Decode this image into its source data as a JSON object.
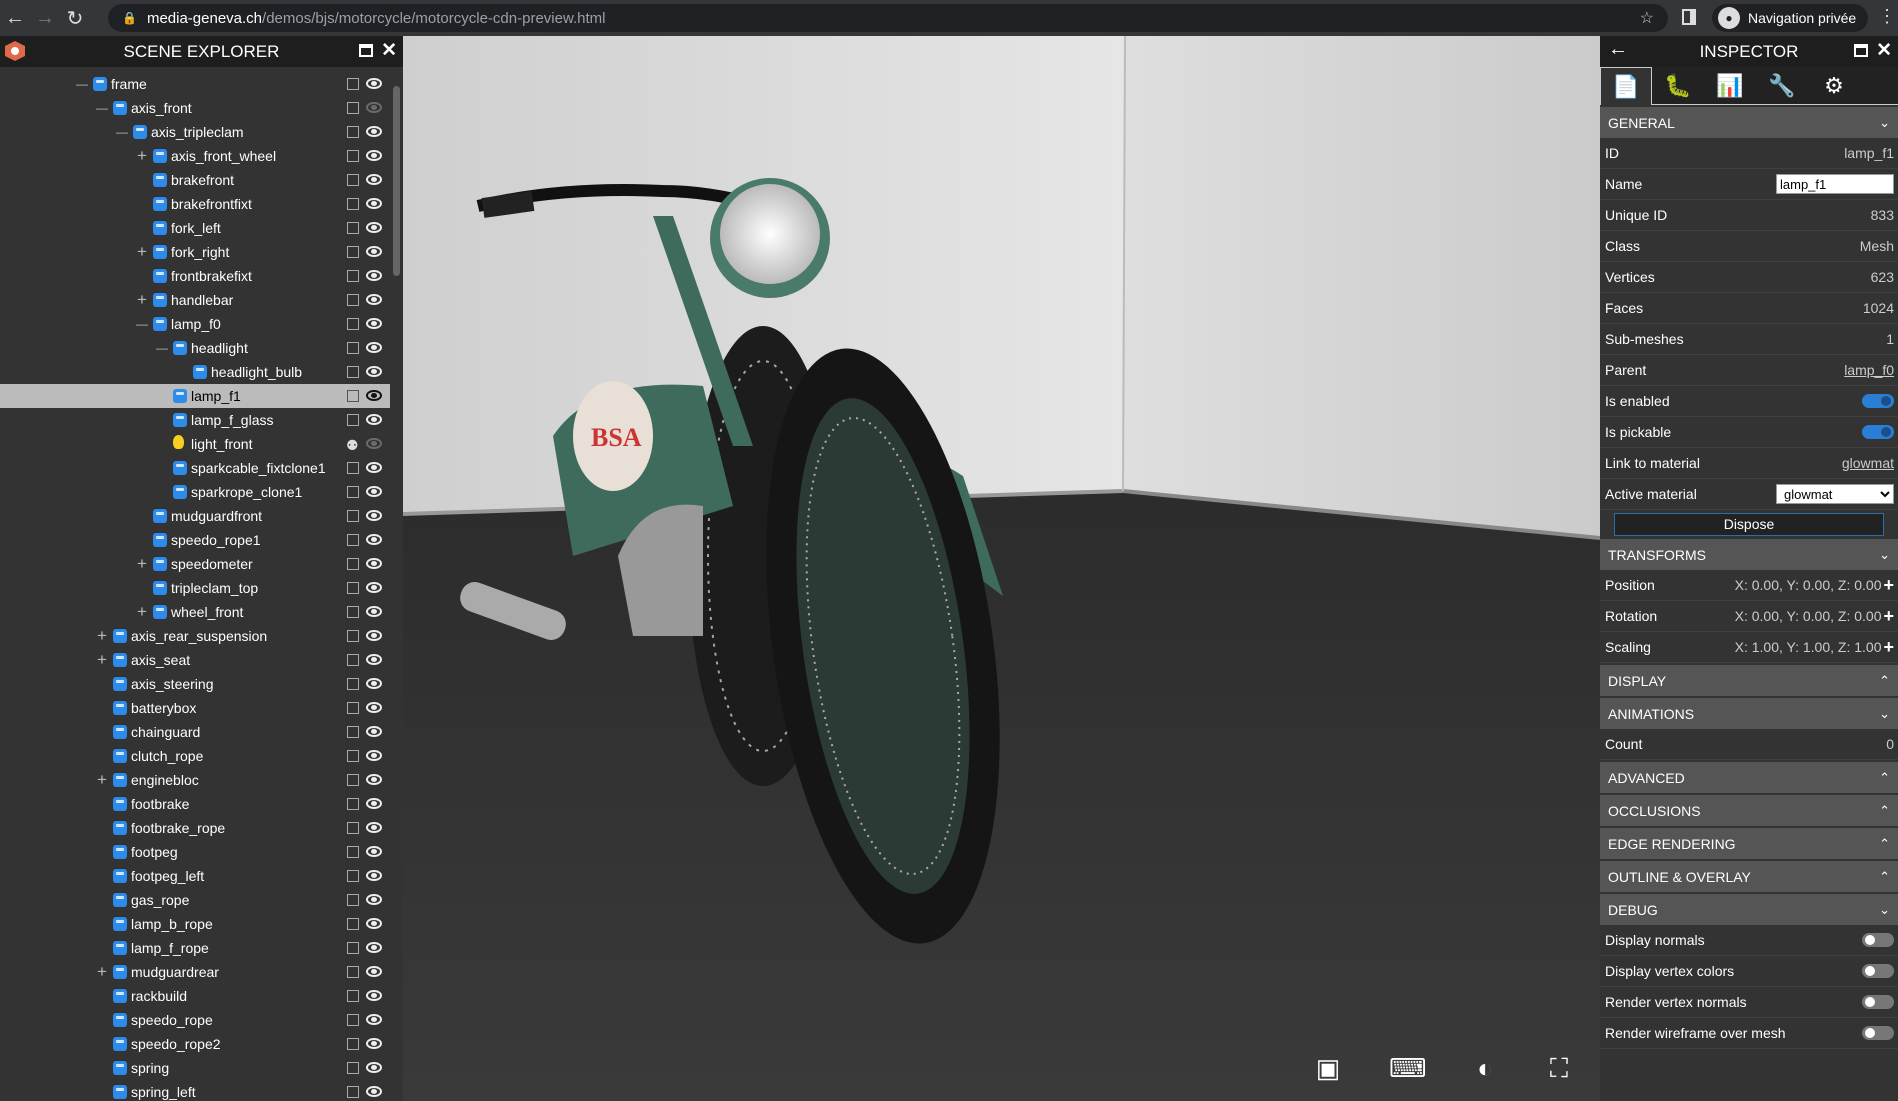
{
  "browser": {
    "url_host": "media-geneva.ch",
    "url_path": "/demos/bjs/motorcycle/motorcycle-cdn-preview.html",
    "private_label": "Navigation privée"
  },
  "explorer": {
    "title": "SCENE EXPLORER",
    "items": [
      {
        "label": "frame",
        "level": 0,
        "exp": "-"
      },
      {
        "label": "axis_front",
        "level": 1,
        "exp": "-",
        "hidden": true
      },
      {
        "label": "axis_tripleclam",
        "level": 2,
        "exp": "-"
      },
      {
        "label": "axis_front_wheel",
        "level": 3,
        "exp": "+"
      },
      {
        "label": "brakefront",
        "level": 3
      },
      {
        "label": "brakefrontfixt",
        "level": 3
      },
      {
        "label": "fork_left",
        "level": 3
      },
      {
        "label": "fork_right",
        "level": 3,
        "exp": "+"
      },
      {
        "label": "frontbrakefixt",
        "level": 3
      },
      {
        "label": "handlebar",
        "level": 3,
        "exp": "+"
      },
      {
        "label": "lamp_f0",
        "level": 3,
        "exp": "-"
      },
      {
        "label": "headlight",
        "level": 4,
        "exp": "-"
      },
      {
        "label": "headlight_bulb",
        "level": 5
      },
      {
        "label": "lamp_f1",
        "level": 4,
        "selected": true
      },
      {
        "label": "lamp_f_glass",
        "level": 4
      },
      {
        "label": "light_front",
        "level": 4,
        "type": "light"
      },
      {
        "label": "sparkcable_fixtclone1",
        "level": 4
      },
      {
        "label": "sparkrope_clone1",
        "level": 4
      },
      {
        "label": "mudguardfront",
        "level": 3
      },
      {
        "label": "speedo_rope1",
        "level": 3
      },
      {
        "label": "speedometer",
        "level": 3,
        "exp": "+"
      },
      {
        "label": "tripleclam_top",
        "level": 3
      },
      {
        "label": "wheel_front",
        "level": 3,
        "exp": "+"
      },
      {
        "label": "axis_rear_suspension",
        "level": 1,
        "exp": "+"
      },
      {
        "label": "axis_seat",
        "level": 1,
        "exp": "+"
      },
      {
        "label": "axis_steering",
        "level": 1
      },
      {
        "label": "batterybox",
        "level": 1
      },
      {
        "label": "chainguard",
        "level": 1
      },
      {
        "label": "clutch_rope",
        "level": 1
      },
      {
        "label": "enginebloc",
        "level": 1,
        "exp": "+"
      },
      {
        "label": "footbrake",
        "level": 1
      },
      {
        "label": "footbrake_rope",
        "level": 1
      },
      {
        "label": "footpeg",
        "level": 1
      },
      {
        "label": "footpeg_left",
        "level": 1
      },
      {
        "label": "gas_rope",
        "level": 1
      },
      {
        "label": "lamp_b_rope",
        "level": 1
      },
      {
        "label": "lamp_f_rope",
        "level": 1
      },
      {
        "label": "mudguardrear",
        "level": 1,
        "exp": "+"
      },
      {
        "label": "rackbuild",
        "level": 1
      },
      {
        "label": "speedo_rope",
        "level": 1
      },
      {
        "label": "speedo_rope2",
        "level": 1
      },
      {
        "label": "spring",
        "level": 1
      },
      {
        "label": "spring_left",
        "level": 1
      }
    ]
  },
  "viewport": {
    "tank_logo": "BSA",
    "buttons": [
      "screenshot-icon",
      "keyboard-icon",
      "contrast-icon",
      "fullscreen-icon"
    ]
  },
  "inspector": {
    "title": "INSPECTOR",
    "tabs": [
      "properties-icon",
      "debug-icon",
      "statistics-icon",
      "tools-icon",
      "settings-icon"
    ],
    "general": {
      "title": "GENERAL",
      "id": "lamp_f1",
      "name": "lamp_f1",
      "unique_id": "833",
      "class": "Mesh",
      "vertices": "623",
      "faces": "1024",
      "submeshes": "1",
      "parent": "lamp_f0",
      "is_enabled": true,
      "is_pickable": true,
      "link_to_material": "glowmat",
      "active_material": "glowmat",
      "dispose": "Dispose",
      "labels": {
        "id": "ID",
        "name": "Name",
        "unique_id": "Unique ID",
        "class": "Class",
        "vertices": "Vertices",
        "faces": "Faces",
        "submeshes": "Sub-meshes",
        "parent": "Parent",
        "is_enabled": "Is enabled",
        "is_pickable": "Is pickable",
        "link": "Link to material",
        "active": "Active material"
      }
    },
    "transforms": {
      "title": "TRANSFORMS",
      "position_label": "Position",
      "position": "X: 0.00, Y: 0.00, Z: 0.00",
      "rotation_label": "Rotation",
      "rotation": "X: 0.00, Y: 0.00, Z: 0.00",
      "scaling_label": "Scaling",
      "scaling": "X: 1.00, Y: 1.00, Z: 1.00"
    },
    "display": {
      "title": "DISPLAY"
    },
    "animations": {
      "title": "ANIMATIONS",
      "count_label": "Count",
      "count": "0"
    },
    "advanced": {
      "title": "ADVANCED"
    },
    "occlusions": {
      "title": "OCCLUSIONS"
    },
    "edge": {
      "title": "EDGE RENDERING"
    },
    "outline": {
      "title": "OUTLINE & OVERLAY"
    },
    "debug": {
      "title": "DEBUG",
      "items": [
        {
          "label": "Display normals",
          "on": false
        },
        {
          "label": "Display vertex colors",
          "on": false
        },
        {
          "label": "Render vertex normals",
          "on": false
        },
        {
          "label": "Render wireframe over mesh",
          "on": false
        }
      ]
    }
  },
  "colors": {
    "accent": "#2d8ceb",
    "toggle_on": "#2a7fd4",
    "selected_row": "#bbbbbb",
    "motorcycle": "#3f6b5c"
  }
}
